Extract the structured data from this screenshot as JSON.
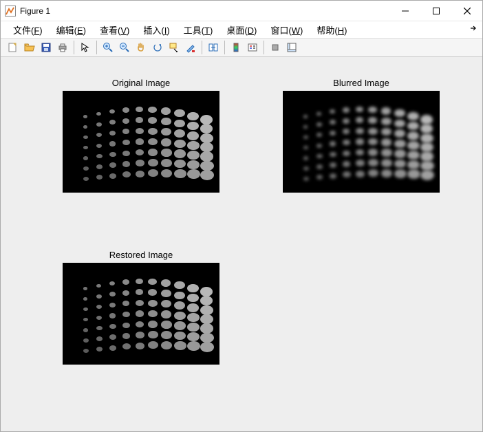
{
  "window": {
    "title": "Figure 1"
  },
  "menus": {
    "file": "文件(F)",
    "edit": "编辑(E)",
    "view": "查看(V)",
    "insert": "插入(I)",
    "tools": "工具(T)",
    "desktop": "桌面(D)",
    "window": "窗口(W)",
    "help": "帮助(H)"
  },
  "subplots": {
    "s1_title": "Original Image",
    "s2_title": "Blurred Image",
    "s3_title": "Restored Image"
  }
}
